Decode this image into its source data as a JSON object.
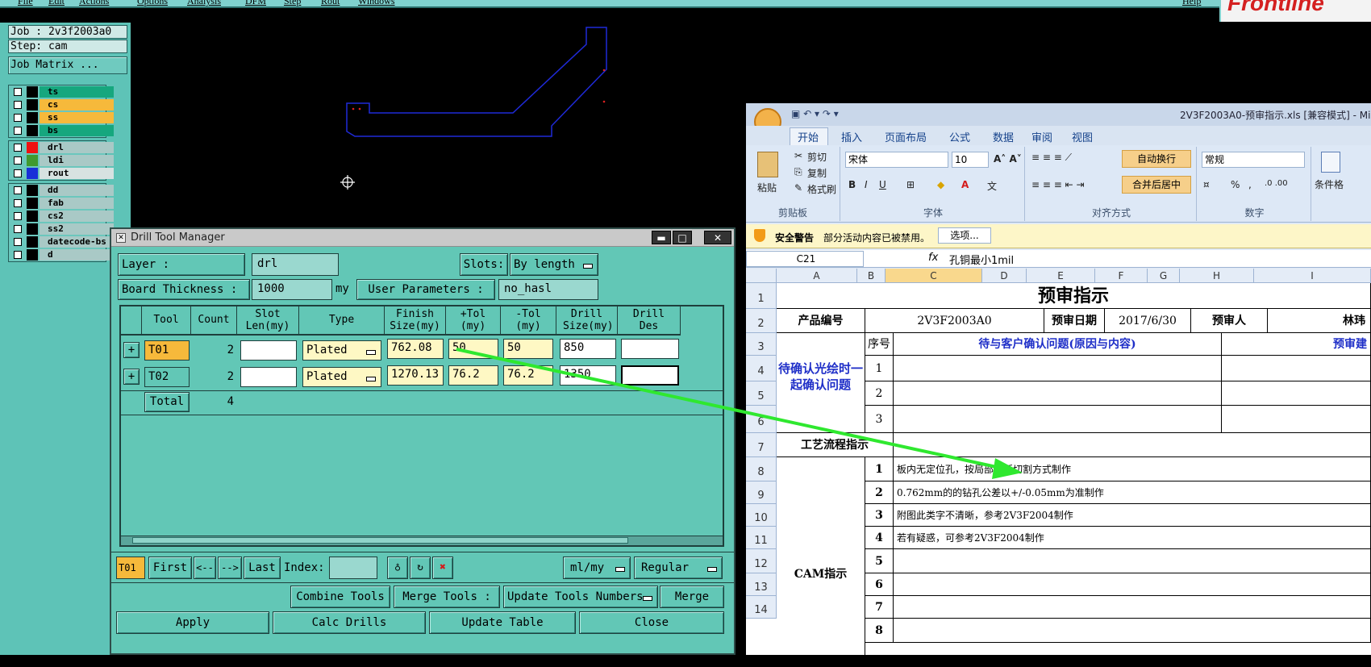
{
  "menu": [
    "File",
    "Edit",
    "Actions",
    "Options",
    "Analysis",
    "DFM",
    "Step",
    "Rout",
    "Windows",
    "Help"
  ],
  "logo_text": "Frontline",
  "job": {
    "job_label": "Job : 2v3f2003a0",
    "step_label": "Step: cam",
    "matrix_button": "Job Matrix ..."
  },
  "layers": {
    "group1": [
      {
        "name": "ts",
        "color": "#16a77e"
      },
      {
        "name": "cs",
        "color": "#f6b93b"
      },
      {
        "name": "ss",
        "color": "#f6b93b"
      },
      {
        "name": "bs",
        "color": "#16a77e"
      }
    ],
    "group2": [
      {
        "name": "drl",
        "color": "#a9c9c6",
        "swatch": "#ee1111"
      },
      {
        "name": "ldi",
        "color": "#a9c9c6",
        "swatch": "#3f9a2f"
      },
      {
        "name": "rout",
        "color": "#d7e2e1",
        "swatch": "#1830d8"
      }
    ],
    "group3": [
      {
        "name": "dd",
        "color": "#a9c9c6"
      },
      {
        "name": "fab",
        "color": "#a9c9c6"
      },
      {
        "name": "cs2",
        "color": "#a9c9c6"
      },
      {
        "name": "ss2",
        "color": "#a9c9c6"
      },
      {
        "name": "datecode-bs",
        "color": "#a9c9c6"
      },
      {
        "name": "d",
        "color": "#a9c9c6"
      }
    ]
  },
  "dtm": {
    "title": "Drill Tool Manager",
    "layer_label": "Layer        :",
    "layer_value": "drl",
    "slots_label": "Slots:",
    "slots_value": "By length",
    "board_label": "Board Thickness :",
    "board_value": "1000",
    "board_unit": "my",
    "user_params_button": "User Parameters :",
    "user_params_value": "no_hasl",
    "headers": [
      "Tool",
      "Count",
      "Slot Len(my)",
      "Type",
      "Finish Size(my)",
      "+Tol (my)",
      "-Tol (my)",
      "Drill Size(my)",
      "Drill Des"
    ],
    "rows": [
      {
        "tool": "T01",
        "count": "2",
        "slot": "",
        "type": "Plated",
        "finish": "762.08",
        "ptol": "50",
        "mtol": "50",
        "drill": "850",
        "des": ""
      },
      {
        "tool": "T02",
        "count": "2",
        "slot": "",
        "type": "Plated",
        "finish": "1270.13",
        "ptol": "76.2",
        "mtol": "76.2",
        "drill": "1350",
        "des": ""
      }
    ],
    "total_label": "Total",
    "total_count": "4",
    "nav": {
      "current": "T01",
      "first": "First",
      "prev": "<--",
      "next": "-->",
      "last": "Last",
      "index_label": "Index:",
      "units": "ml/my",
      "mode": "Regular"
    },
    "combine": "Combine Tools",
    "merge_label": "Merge Tools :",
    "update_numbers": "Update Tools Numbers",
    "merge": "Merge",
    "apply": "Apply",
    "calc": "Calc Drills",
    "update_table": "Update Table",
    "close": "Close"
  },
  "excel": {
    "title": "2V3F2003A0-预审指示.xls [兼容模式] - Mi",
    "tabs": [
      "开始",
      "插入",
      "页面布局",
      "公式",
      "数据",
      "审阅",
      "视图"
    ],
    "clipboard": {
      "paste": "粘贴",
      "cut": "剪切",
      "copy": "复制",
      "format": "格式刷",
      "group": "剪贴板"
    },
    "font": {
      "name": "宋体",
      "size": "10",
      "group": "字体"
    },
    "align": {
      "wrap": "自动换行",
      "merge": "合并后居中",
      "group": "对齐方式"
    },
    "number": {
      "format": "常规",
      "percent": "%",
      "group": "数字"
    },
    "styles_label": "条件格",
    "security": {
      "title": "安全警告",
      "text": "部分活动内容已被禁用。",
      "button": "选项..."
    },
    "namebox": "C21",
    "fx": "fx",
    "formula": "孔铜最小1mil",
    "columns": [
      "A",
      "B",
      "C",
      "D",
      "E",
      "F",
      "G",
      "H",
      "I"
    ],
    "row_numbers": [
      "1",
      "2",
      "3",
      "4",
      "5",
      "6",
      "7",
      "8",
      "9",
      "10",
      "11",
      "12",
      "13",
      "14"
    ],
    "sheet_title": "预审指示",
    "product_label": "产品编号",
    "product_value": "2V3F2003A0",
    "date_label": "预审日期",
    "date_value": "2017/6/30",
    "reviewer_label": "预审人",
    "reviewer_value": "林玮",
    "seq_label": "序号",
    "confirm_header": "待与客户确认问题(原因与内容)",
    "pre_header": "预审建",
    "left_label": "待确认光绘时一起确认问题",
    "nums_top": [
      "1",
      "2",
      "3"
    ],
    "process_label": "工艺流程指示",
    "cam_label": "CAM指示",
    "cam_nums": [
      "1",
      "2",
      "3",
      "4",
      "5",
      "6",
      "7",
      "8"
    ],
    "cam_notes": [
      "板内无定位孔，按局部小板切割方式制作",
      "0.762mm的的钻孔公差以+/-0.05mm为准制作",
      "附图此类字不清晰，参考2V3F2004制作",
      "若有疑惑，可参考2V3F2004制作"
    ]
  }
}
